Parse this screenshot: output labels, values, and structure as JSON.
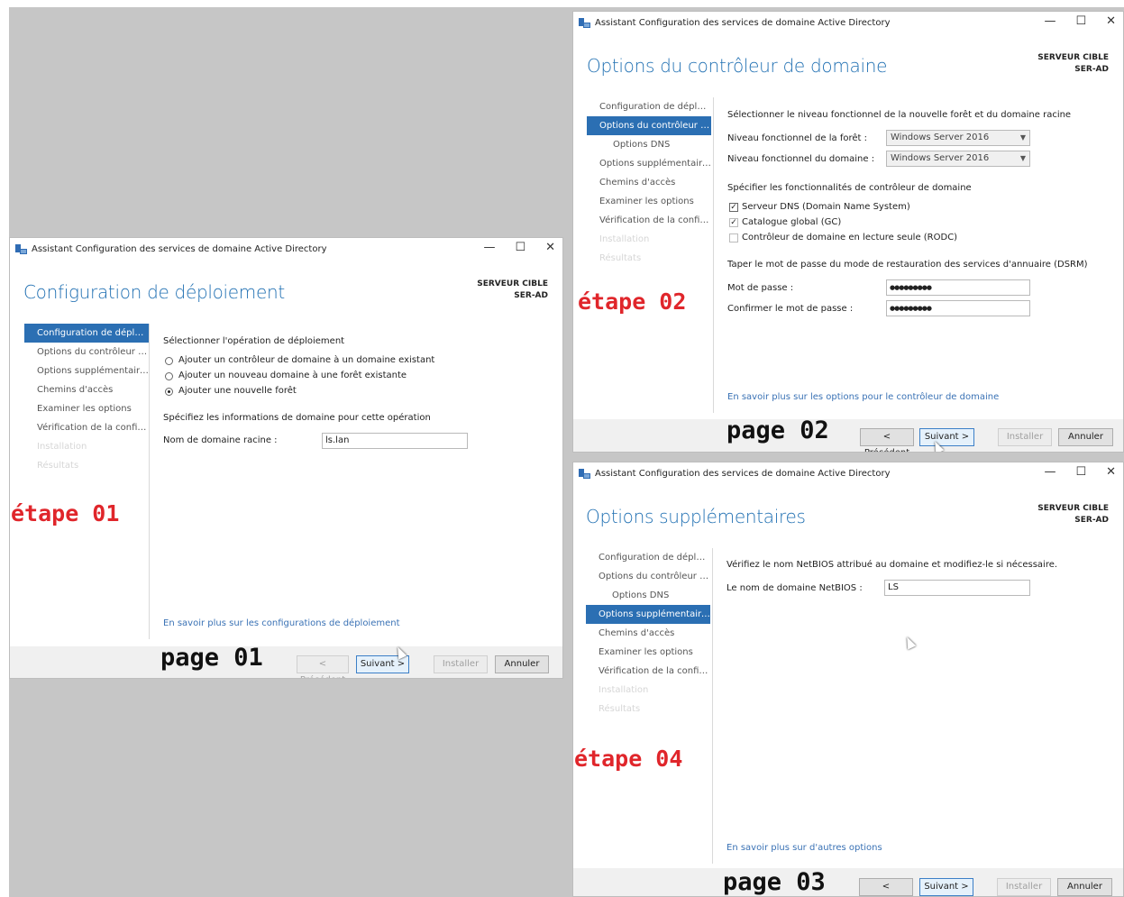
{
  "window_title": "Assistant Configuration des services de domaine Active Directory",
  "window_controls": {
    "minimize": "—",
    "maximize": "☐",
    "close": "✕"
  },
  "server_target": {
    "label": "SERVEUR CIBLE",
    "name": "SER-AD"
  },
  "nav_items": [
    "Configuration de déploie...",
    "Options du contrôleur de...",
    "Options DNS",
    "Options supplémentaires",
    "Chemins d'accès",
    "Examiner les options",
    "Vérification de la configur...",
    "Installation",
    "Résultats"
  ],
  "nav_items_page01": [
    "Configuration de déploie...",
    "Options du contrôleur de...",
    "Options supplémentaires",
    "Chemins d'accès",
    "Examiner les options",
    "Vérification de la configur...",
    "Installation",
    "Résultats"
  ],
  "buttons": {
    "previous": "< Précédent",
    "next": "Suivant >",
    "install": "Installer",
    "cancel": "Annuler"
  },
  "page01": {
    "title": "Configuration de déploiement",
    "section_label": "Sélectionner l'opération de déploiement",
    "options": [
      "Ajouter un contrôleur de domaine à un domaine existant",
      "Ajouter un nouveau domaine à une forêt existante",
      "Ajouter une nouvelle forêt"
    ],
    "selected_option": 2,
    "spec_label": "Spécifiez les informations de domaine pour cette opération",
    "root_domain_label": "Nom de domaine racine :",
    "root_domain_value": "ls.lan",
    "link": "En savoir plus sur les configurations de déploiement",
    "page_label": "page 01",
    "step_label": "étape 01"
  },
  "page02": {
    "title": "Options du contrôleur de domaine",
    "functional_level_label": "Sélectionner le niveau fonctionnel de la nouvelle forêt et du domaine racine",
    "forest_level_label": "Niveau fonctionnel de la forêt :",
    "forest_level_value": "Windows Server 2016",
    "domain_level_label": "Niveau fonctionnel du domaine :",
    "domain_level_value": "Windows Server 2016",
    "capabilities_label": "Spécifier les fonctionnalités de contrôleur de domaine",
    "capabilities": [
      {
        "label": "Serveur DNS (Domain Name System)",
        "checked": true,
        "enabled": true
      },
      {
        "label": "Catalogue global (GC)",
        "checked": true,
        "enabled": false
      },
      {
        "label": "Contrôleur de domaine en lecture seule (RODC)",
        "checked": false,
        "enabled": false
      }
    ],
    "dsrm_label": "Taper le mot de passe du mode de restauration des services d'annuaire (DSRM)",
    "password_label": "Mot de passe :",
    "password_value": "●●●●●●●●●",
    "confirm_label": "Confirmer le mot de passe :",
    "confirm_value": "●●●●●●●●●",
    "link": "En savoir plus sur les options pour le contrôleur de domaine",
    "page_label": "page 02",
    "step_label": "étape 02"
  },
  "page03": {
    "title": "Options supplémentaires",
    "netbios_info": "Vérifiez le nom NetBIOS attribué au domaine et modifiez-le si nécessaire.",
    "netbios_label": "Le nom de domaine NetBIOS :",
    "netbios_value": "LS",
    "link": "En savoir plus sur d'autres options",
    "page_label": "page 03",
    "step_label": "étape 04"
  }
}
